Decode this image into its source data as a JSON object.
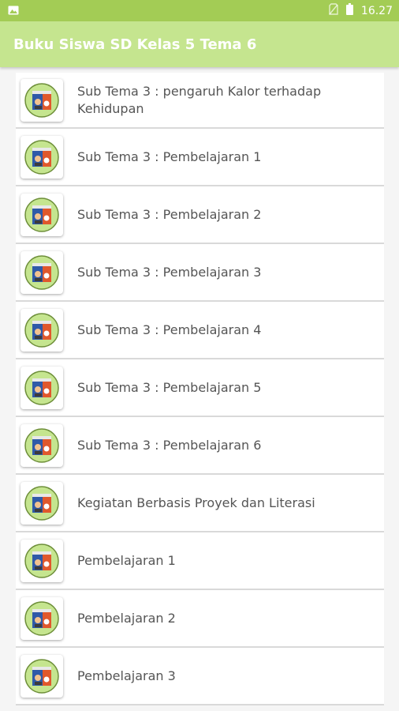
{
  "status_bar": {
    "time": "16.27",
    "icons": [
      "image-icon",
      "no-sim-icon",
      "battery-icon"
    ]
  },
  "app_bar": {
    "title": "Buku Siswa SD Kelas 5 Tema 6"
  },
  "colors": {
    "status_bar": "#a3cc55",
    "app_bar": "#c5e58f",
    "item_text": "#555555"
  },
  "items": [
    {
      "label": "Sub Tema 3 : pengaruh Kalor terhadap Kehidupan",
      "icon": "book-cover-icon"
    },
    {
      "label": "Sub Tema 3 : Pembelajaran 1",
      "icon": "book-cover-icon"
    },
    {
      "label": "Sub Tema 3 : Pembelajaran 2",
      "icon": "book-cover-icon"
    },
    {
      "label": "Sub Tema 3 : Pembelajaran 3",
      "icon": "book-cover-icon"
    },
    {
      "label": "Sub Tema 3 : Pembelajaran 4",
      "icon": "book-cover-icon"
    },
    {
      "label": "Sub Tema 3 : Pembelajaran 5",
      "icon": "book-cover-icon"
    },
    {
      "label": "Sub Tema 3 : Pembelajaran 6",
      "icon": "book-cover-icon"
    },
    {
      "label": "Kegiatan Berbasis Proyek dan Literasi",
      "icon": "book-cover-icon"
    },
    {
      "label": "Pembelajaran 1",
      "icon": "book-cover-icon"
    },
    {
      "label": "Pembelajaran 2",
      "icon": "book-cover-icon"
    },
    {
      "label": "Pembelajaran 3",
      "icon": "book-cover-icon"
    }
  ]
}
